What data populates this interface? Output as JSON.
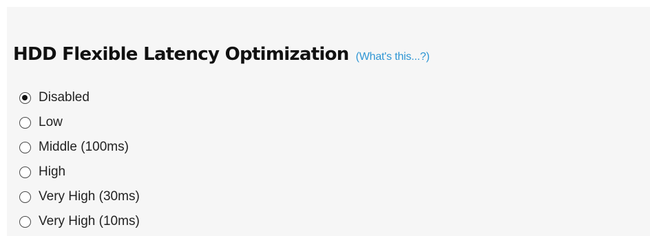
{
  "section": {
    "title": "HDD Flexible Latency Optimization",
    "help_link": "(What's this...?)"
  },
  "options": [
    {
      "label": "Disabled",
      "selected": true
    },
    {
      "label": "Low",
      "selected": false
    },
    {
      "label": "Middle (100ms)",
      "selected": false
    },
    {
      "label": "High",
      "selected": false
    },
    {
      "label": "Very High (30ms)",
      "selected": false
    },
    {
      "label": "Very High (10ms)",
      "selected": false
    }
  ],
  "colors": {
    "link": "#2f96d4",
    "panel_background": "#f6f6f6"
  }
}
